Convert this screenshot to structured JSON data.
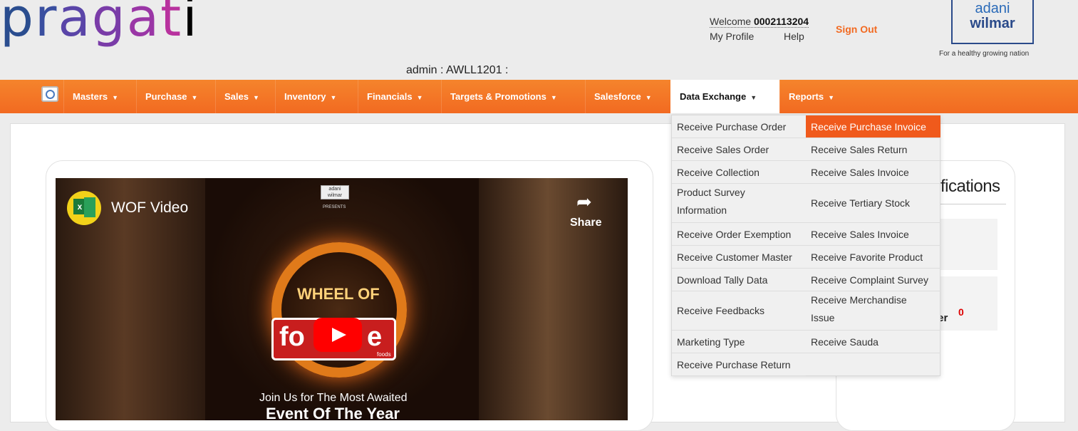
{
  "header": {
    "logo_letters": [
      "p",
      "r",
      "a",
      "g",
      "a",
      "t",
      "i"
    ],
    "welcome_text": "Welcome",
    "user_id": "0002113204",
    "my_profile": "My Profile",
    "help": "Help",
    "sign_out": "Sign Out",
    "brand_line1": "adani",
    "brand_line2": "wilmar",
    "tagline": "For a healthy growing nation",
    "admin": "admin : AWLL1201 :"
  },
  "nav": {
    "search_icon": "search-icon",
    "items": [
      {
        "label": "Masters",
        "caret": "▼"
      },
      {
        "label": "Purchase",
        "caret": "▼"
      },
      {
        "label": "Sales",
        "caret": "▼"
      },
      {
        "label": "Inventory",
        "caret": "▼"
      },
      {
        "label": "Financials",
        "caret": "▼"
      },
      {
        "label": "Targets & Promotions",
        "caret": "▼"
      },
      {
        "label": "Salesforce",
        "caret": "▼"
      },
      {
        "label": "Data Exchange",
        "caret": "▼"
      },
      {
        "label": "Reports",
        "caret": "▼"
      }
    ]
  },
  "dropdown": {
    "left": [
      "Receive Purchase Order",
      "Receive Sales Order",
      "Receive Collection",
      "Product Survey",
      "Information",
      "Receive Order Exemption",
      "Receive Customer Master",
      "Download Tally Data",
      "Receive Feedbacks",
      "Marketing Type",
      "Receive Purchase Return"
    ],
    "right": [
      "Receive Purchase Invoice",
      "Receive Sales Return",
      "Receive Sales Invoice",
      "Receive Tertiary Stock",
      "Receive Sales Invoice",
      "Receive Favorite Product",
      "Receive Complaint Survey",
      "Receive Merchandise",
      "Issue",
      "Receive Sauda"
    ]
  },
  "video": {
    "title": "WOF Video",
    "share": "Share",
    "share_icon": "share-arrow-icon",
    "mini_brand_1": "adani",
    "mini_brand_2": "wilmar",
    "presents": "PRESENTS",
    "wheel_label": "WHEEL OF",
    "fortune_left": "fo",
    "fortune_right": "e",
    "foods": "foods",
    "line1": "Join Us for The Most Awaited",
    "line2": "Event Of The Year"
  },
  "notifications": {
    "title": "fications",
    "text": "der",
    "count": "0"
  },
  "colors": {
    "accent": "#f26a21",
    "highlight": "#f05a1c",
    "count": "#dd0000"
  }
}
